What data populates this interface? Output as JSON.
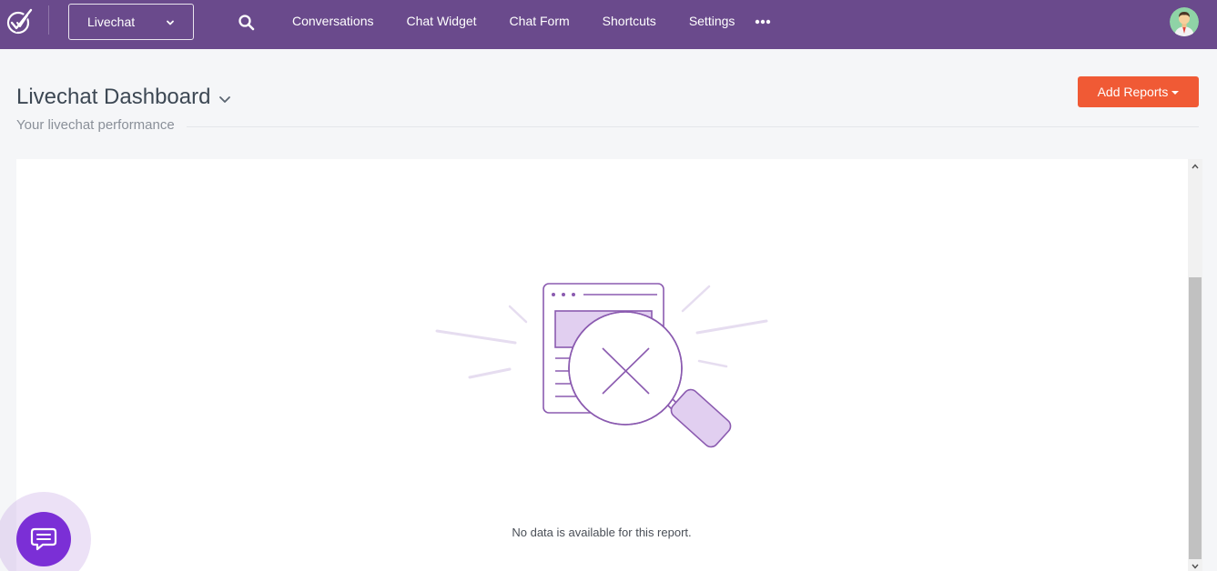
{
  "topbar": {
    "app_selector": {
      "value": "Livechat"
    },
    "nav_items": [
      {
        "label": "Conversations"
      },
      {
        "label": "Chat Widget"
      },
      {
        "label": "Chat Form"
      },
      {
        "label": "Shortcuts"
      },
      {
        "label": "Settings"
      }
    ],
    "icons": [
      "logo-icon",
      "search-icon",
      "more-icon",
      "avatar"
    ],
    "color": "#6a4a8c"
  },
  "header": {
    "title": "Livechat Dashboard",
    "subtitle": "Your livechat performance",
    "add_reports_label": "Add Reports",
    "accent": "#f05a35"
  },
  "report": {
    "empty_message": "No data is available for this report."
  },
  "chat_launcher": {
    "color": "#7b2fd6",
    "icon": "chat-bubble-icon"
  }
}
